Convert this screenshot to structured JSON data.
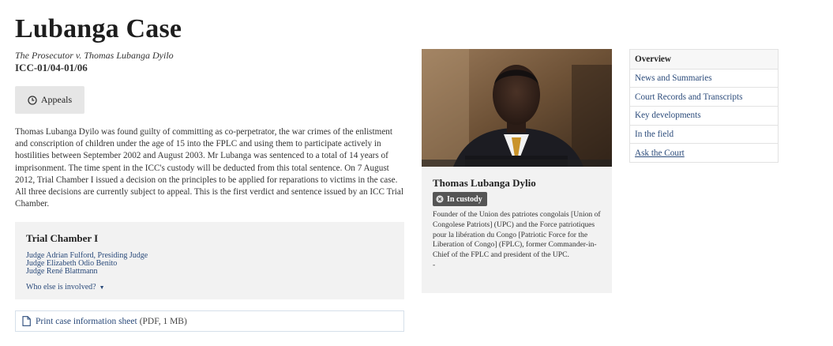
{
  "case": {
    "title": "Lubanga Case",
    "subtitle": "The Prosecutor v. Thomas Lubanga Dyilo",
    "id": "ICC-01/04-01/06"
  },
  "status_button": {
    "label": "Appeals",
    "icon": "clock-icon"
  },
  "summary": "Thomas Lubanga Dyilo was found guilty of committing as co-perpetrator, the war crimes of the enlistment and conscription of children under the age of 15 into the FPLC and using them to participate actively in hostilities between September 2002 and August 2003. Mr Lubanga was sentenced to a total of 14 years of imprisonment. The time spent in the ICC's custody will be deducted from this total sentence. On 7 August 2012, Trial Chamber I issued a decision on the principles to be applied for reparations to victims in the case. All three decisions are currently subject to appeal. This is the first verdict and sentence issued by an ICC Trial Chamber.",
  "chamber": {
    "title": "Trial Chamber I",
    "judges": [
      "Judge Adrian Fulford, Presiding Judge",
      "Judge Elizabeth Odio Benito",
      "Judge René Blattmann"
    ],
    "who_else": "Who else is involved?",
    "caret": "▼"
  },
  "print": {
    "link": "Print case information sheet",
    "meta": "(PDF, 1 MB)",
    "icon": "document-icon"
  },
  "profile": {
    "name": "Thomas Lubanga Dylio",
    "badge": "In custody",
    "badge_icon": "close-circle-icon",
    "bio": "Founder of the Union des patriotes congolais [Union of Congolese Patriots] (UPC) and the Force patriotiques pour la libération du Congo [Patriotic Force for the Liberation of Congo] (FPLC), former Commander-in-Chief of the FPLC and president of the UPC.",
    "bio_trailer": "-"
  },
  "nav": {
    "items": [
      {
        "label": "Overview",
        "active": true
      },
      {
        "label": "News and Summaries"
      },
      {
        "label": "Court Records and Transcripts"
      },
      {
        "label": "Key developments"
      },
      {
        "label": "In the field"
      },
      {
        "label": "Ask the Court",
        "underline": true
      }
    ]
  },
  "colors": {
    "link": "#2a4a7a",
    "panel_bg": "#f2f2f2",
    "badge_bg": "#555555"
  }
}
